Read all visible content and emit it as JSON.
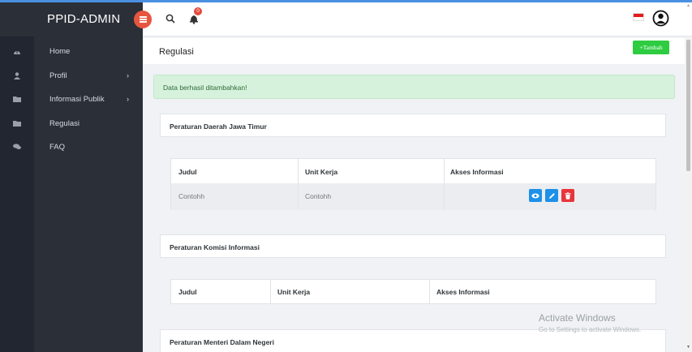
{
  "app": {
    "brand": "PPID-ADMIN"
  },
  "sidebar": {
    "items": [
      {
        "label": "Home",
        "icon": "dashboard-icon",
        "has_submenu": false
      },
      {
        "label": "Profil",
        "icon": "user-icon",
        "has_submenu": true
      },
      {
        "label": "Informasi Publik",
        "icon": "folder-icon",
        "has_submenu": true
      },
      {
        "label": "Regulasi",
        "icon": "folder-icon",
        "has_submenu": false
      },
      {
        "label": "FAQ",
        "icon": "comments-icon",
        "has_submenu": false
      }
    ]
  },
  "header": {
    "notification_count": "0",
    "language_flag": "indonesia-flag"
  },
  "page": {
    "title": "Regulasi",
    "add_button_label": "+Tambah"
  },
  "alert": {
    "message": "Data berhasil ditambahkan!"
  },
  "sections": [
    {
      "title": "Peraturan Daerah Jawa Timur",
      "columns": [
        "Judul",
        "Unit Kerja",
        "Akses Informasi"
      ],
      "rows": [
        {
          "judul": "Contohh",
          "unit_kerja": "Contohh"
        }
      ]
    },
    {
      "title": "Peraturan Komisi Informasi",
      "columns": [
        "Judul",
        "Unit Kerja",
        "Akses Informasi"
      ],
      "rows": []
    },
    {
      "title": "Peraturan Menteri Dalam Negeri",
      "columns": [],
      "rows": []
    }
  ],
  "watermark": {
    "line1": "Activate Windows",
    "line2": "Go to Settings to activate Windows."
  },
  "colors": {
    "sidebar_bg": "#2b2f38",
    "accent_green": "#2ecc40",
    "alert_bg": "#d7f2dc",
    "action_blue": "#1e90e8",
    "action_red": "#e8343a",
    "toggle_orange": "#e8553e"
  }
}
